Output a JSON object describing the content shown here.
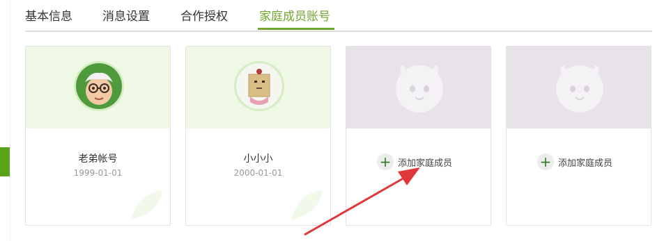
{
  "tabs": [
    {
      "label": "基本信息"
    },
    {
      "label": "消息设置"
    },
    {
      "label": "合作授权"
    },
    {
      "label": "家庭成员账号"
    }
  ],
  "members": [
    {
      "name": "老弟帐号",
      "birthdate": "1999-01-01",
      "avatar": "grandpa-avatar-icon"
    },
    {
      "name": "小小小",
      "birthdate": "2000-01-01",
      "avatar": "paper-bag-girl-avatar-icon"
    }
  ],
  "add_slots": [
    {
      "label": "添加家庭成员"
    },
    {
      "label": "添加家庭成员"
    }
  ],
  "colors": {
    "accent": "#6fa52d",
    "member_card_top": "#eef8e4",
    "empty_card_top": "#e7e3e8",
    "annotation_arrow": "#e0383a"
  }
}
